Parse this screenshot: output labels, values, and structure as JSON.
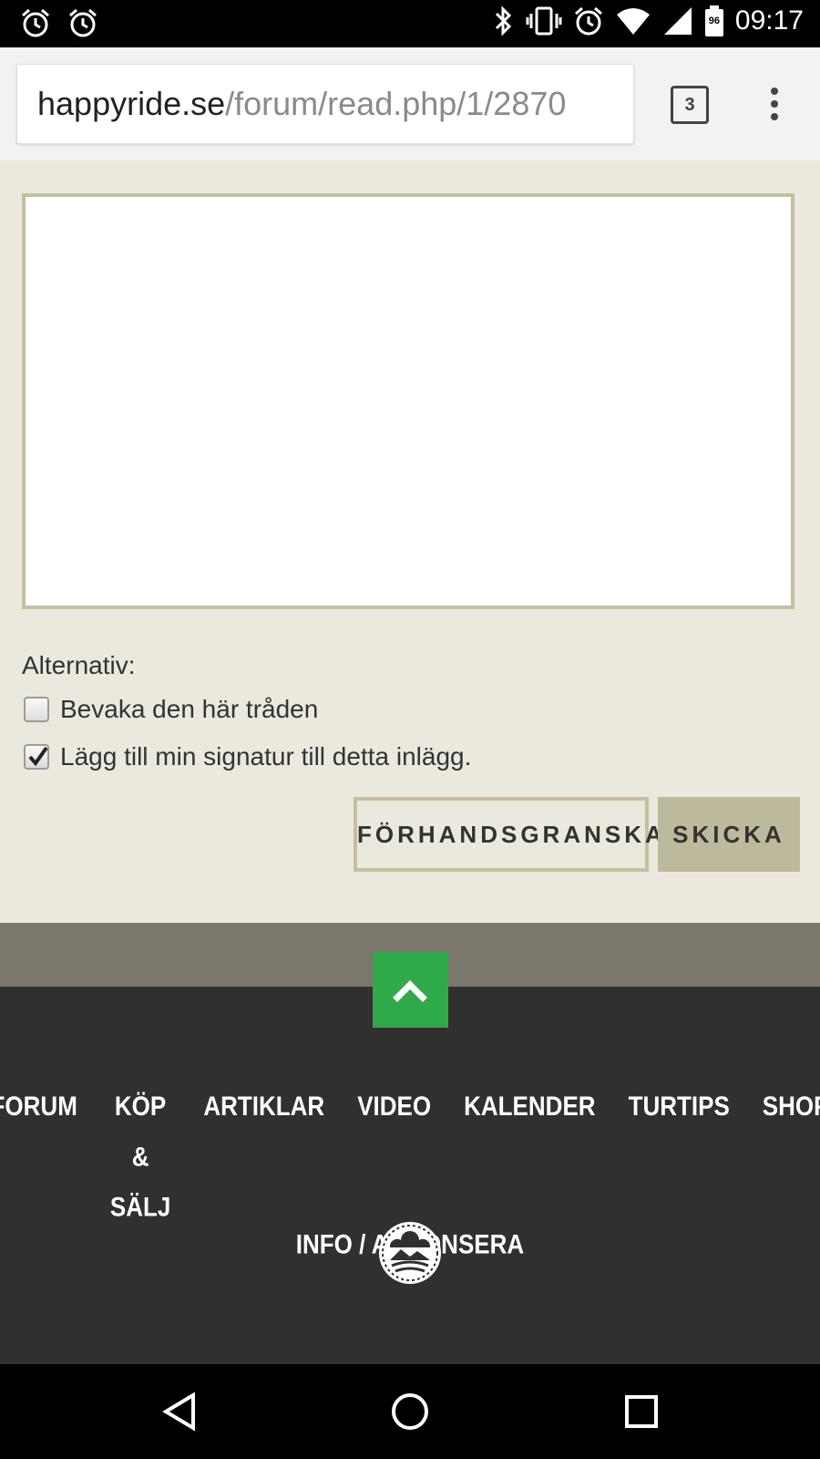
{
  "status_bar": {
    "time": "09:17",
    "battery_level": "96"
  },
  "browser": {
    "url_domain": "happyride.se",
    "url_path": "/forum/read.php/1/2870",
    "tab_count": "3"
  },
  "form": {
    "textarea_value": "",
    "options_label": "Alternativ:",
    "options": [
      {
        "label": "Bevaka den här tråden",
        "checked": false
      },
      {
        "label": "Lägg till min signatur till detta inlägg.",
        "checked": true
      }
    ],
    "preview_label": "FÖRHANDSGRANSKA",
    "send_label": "SKICKA"
  },
  "footer": {
    "nav_row1": [
      "FORUM",
      "KÖP & SÄLJ",
      "ARTIKLAR",
      "VIDEO",
      "KALENDER",
      "TURTIPS",
      "SHOP"
    ],
    "nav_row2": [
      "INFO / ANNONSERA"
    ]
  },
  "colors": {
    "page_bg": "#ebe8dd",
    "accent_border": "#c4c09f",
    "send_button": "#bdb99b",
    "to_top_green": "#2eaa48",
    "footer_bg": "#303030"
  }
}
